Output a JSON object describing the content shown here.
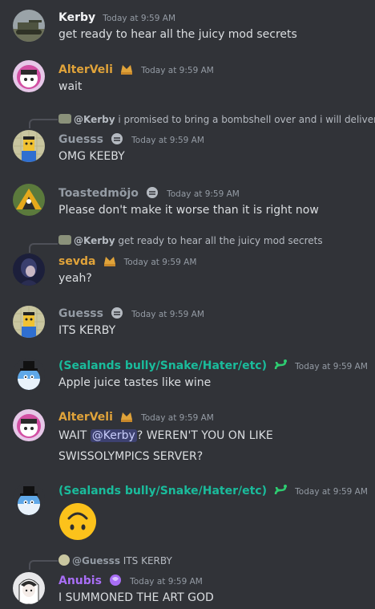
{
  "colors": {
    "background": "#313338",
    "mod_gold": "#e0a33a",
    "grey_name": "#949ba4",
    "teal_name": "#1abc9c",
    "purple_name": "#a86ef5",
    "mention_bg": "#4a4f91"
  },
  "messages": [
    {
      "author": "Kerby",
      "badge_icon": "",
      "time": "Today at 9:59 AM",
      "text": "get ready to hear all the juicy mod secrets",
      "avatar_icon": "tank-avatar"
    },
    {
      "author": "AlterVeli",
      "badge_icon": "gold-crown-badge-icon",
      "time": "Today at 9:59 AM",
      "text": "wait",
      "avatar_icon": "pink-character-avatar"
    },
    {
      "reply_to": "@Kerby",
      "reply_text": "i promised to bring a bombshell over and i will deliver",
      "author": "Guesss",
      "badge_icon": "grey-badge-icon",
      "time": "Today at 9:59 AM",
      "text": "OMG KEEBY",
      "avatar_icon": "yellow-character-avatar"
    },
    {
      "author": "Toastedmöjo",
      "badge_icon": "grey-badge-icon",
      "time": "Today at 9:59 AM",
      "text": "Please don't make it worse than it is right now",
      "avatar_icon": "bird-avatar"
    },
    {
      "reply_to": "@Kerby",
      "reply_text": "get ready to hear all the juicy mod secrets",
      "author": "sevda",
      "badge_icon": "gold-crown-badge-icon",
      "time": "Today at 9:59 AM",
      "text": "yeah?",
      "avatar_icon": "dark-portrait-avatar"
    },
    {
      "author": "Guesss",
      "badge_icon": "grey-badge-icon",
      "time": "Today at 9:59 AM",
      "text": "ITS KERBY",
      "avatar_icon": "yellow-character-avatar"
    },
    {
      "author": "(Sealands bully/Snake/Hater/etc)",
      "badge_icon": "green-snake-badge-icon",
      "time": "Today at 9:59 AM",
      "text": "Apple juice tastes like wine",
      "avatar_icon": "blue-ball-hat-avatar"
    },
    {
      "author": "AlterVeli",
      "badge_icon": "gold-crown-badge-icon",
      "time": "Today at 9:59 AM",
      "text_before": "WAIT ",
      "mention": "@Kerby",
      "text_after": "? WEREN'T YOU ON LIKE",
      "text_line2": "SWISSOLYMPICS SERVER?",
      "avatar_icon": "pink-character-avatar"
    },
    {
      "author": "(Sealands bully/Snake/Hater/etc)",
      "badge_icon": "green-snake-badge-icon",
      "time": "Today at 9:59 AM",
      "emoji": "upside-down-face-emoji",
      "avatar_icon": "blue-ball-hat-avatar"
    },
    {
      "reply_to": "@Guesss",
      "reply_text": "ITS KERBY",
      "author": "Anubis",
      "badge_icon": "purple-badge-icon",
      "time": "Today at 9:59 AM",
      "text": "I SUMMONED THE ART GOD",
      "avatar_icon": "white-hair-avatar"
    }
  ]
}
